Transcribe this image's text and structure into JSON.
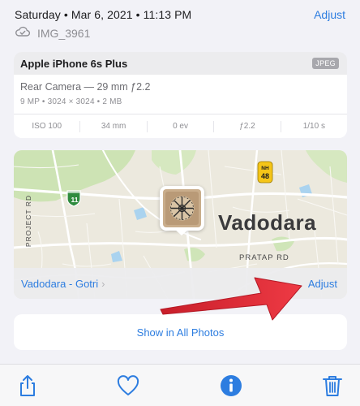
{
  "header": {
    "date_time": "Saturday • Mar 6, 2021 • 11:13 PM",
    "adjust_label": "Adjust"
  },
  "file": {
    "icon": "cloud-icon",
    "name": "IMG_3961"
  },
  "camera": {
    "device": "Apple iPhone 6s Plus",
    "format": "JPEG",
    "lens": "Rear Camera — 29 mm ƒ2.2",
    "specs": "9 MP  •  3024 × 3024  •  2 MB",
    "exif": [
      "ISO 100",
      "34 mm",
      "0 ev",
      "ƒ2.2",
      "1/10 s"
    ]
  },
  "map": {
    "city": "Vadodara",
    "road_label": "PRATAP RD",
    "side_label": "PROJECT RD",
    "shield_11": "11",
    "shield_nh_top": "NH",
    "shield_nh_num": "48",
    "location_name": "Vadodara - Gotri",
    "location_adjust": "Adjust",
    "colors": {
      "land": "#ece9de",
      "green": "#c9e2b0",
      "road": "#ffffff",
      "water": "#aad3ef"
    }
  },
  "show_all_label": "Show in All Photos",
  "toolbar": {
    "share_icon": "share-icon",
    "favorite_icon": "heart-icon",
    "info_icon": "info-icon",
    "delete_icon": "trash-icon"
  },
  "accent_color": "#2d7de0",
  "annotation_color": "#e0303a"
}
